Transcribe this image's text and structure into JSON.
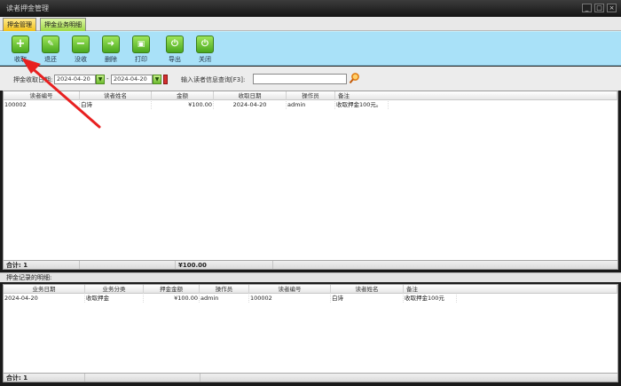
{
  "window": {
    "title": "读者押金管理"
  },
  "tabs": [
    {
      "label": "押金管理",
      "active": true
    },
    {
      "label": "押金业务明细",
      "active": false
    }
  ],
  "toolbar": [
    {
      "label": "收取",
      "icon": "plus-icon"
    },
    {
      "label": "退还",
      "icon": "wrench-icon"
    },
    {
      "label": "没收",
      "icon": "minus-icon"
    },
    {
      "label": "删除",
      "icon": "arrow-right-icon"
    },
    {
      "label": "打印",
      "icon": "printer-icon"
    },
    {
      "label": "导出",
      "icon": "power-icon"
    },
    {
      "label": "关闭",
      "icon": "power-icon"
    }
  ],
  "filter": {
    "date_label": "押金收取日期:",
    "date_from": "2024-04-20",
    "date_to": "2024-04-20",
    "separator": "-",
    "search_label": "输入读者信息查询[F3]:",
    "search_value": ""
  },
  "main_grid": {
    "columns": [
      "读者编号",
      "读者姓名",
      "金额",
      "收取日期",
      "操作员",
      "备注"
    ],
    "rows": [
      [
        "100002",
        "白诗",
        "¥100.00",
        "2024-04-20",
        "admin",
        "收取押金100元。"
      ]
    ],
    "footer": {
      "count_label": "合计: 1",
      "total": "¥100.00"
    }
  },
  "detail_section": {
    "caption": "押金记录的明细:",
    "columns": [
      "业务日期",
      "业务分类",
      "押金金额",
      "操作员",
      "读者编号",
      "读者姓名",
      "备注"
    ],
    "rows": [
      [
        "2024-04-20",
        "收取押金",
        "¥100.00",
        "admin",
        "100002",
        "白诗",
        "收取押金100元"
      ]
    ],
    "footer": {
      "count_label": "合计: 1"
    }
  },
  "colors": {
    "toolbar_bg": "#a9e1f8",
    "tab_active": "#f3c21a",
    "tab_inactive": "#9fd944",
    "annotation_arrow": "#e82020"
  }
}
